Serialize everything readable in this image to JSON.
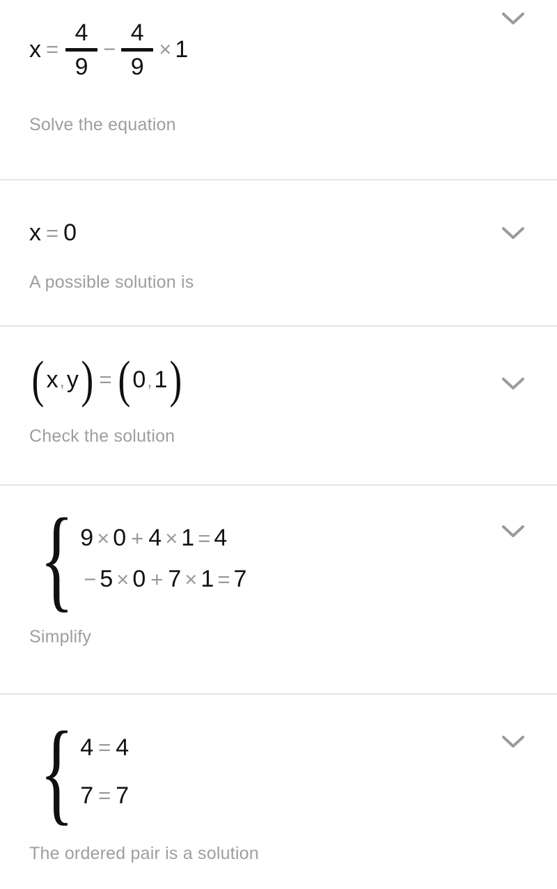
{
  "app": {
    "background_color": "#ffffff",
    "divider_color": "#e6e6e6",
    "rail_color": "#e2e2e2",
    "math_color": "#121212",
    "operator_color": "#9a9a9a",
    "caption_color": "#9e9e9e",
    "chevron_color": "#9b9b9b"
  },
  "steps": [
    {
      "id": "step-solve-equation",
      "caption": "Solve the equation",
      "toggle_icon": "chevron-down-icon",
      "expression": {
        "kind": "fraction-expression",
        "lhs": "x",
        "eq": "=",
        "frac1_num": "4",
        "frac1_den": "9",
        "minus": "−",
        "frac2_num": "4",
        "frac2_den": "9",
        "times": "×",
        "factor": "1"
      }
    },
    {
      "id": "step-possible-solution",
      "caption": "A possible solution is",
      "toggle_icon": "chevron-down-icon",
      "expression": {
        "kind": "simple-equation",
        "lhs": "x",
        "eq": "=",
        "rhs": "0"
      }
    },
    {
      "id": "step-check-solution",
      "caption": "Check the solution",
      "toggle_icon": "chevron-down-icon",
      "expression": {
        "kind": "ordered-pair-equation",
        "open1": "(",
        "var1": "x",
        "comma1": ",",
        "var2": "y",
        "close1": ")",
        "eq": "=",
        "open2": "(",
        "val1": "0",
        "comma2": ",",
        "val2": "1",
        "close2": ")"
      }
    },
    {
      "id": "step-simplify",
      "caption": "Simplify",
      "toggle_icon": "chevron-down-icon",
      "expression": {
        "kind": "system",
        "brace": "{",
        "rows": [
          {
            "t1": "9",
            "o1": "×",
            "t2": "0",
            "o2": "+",
            "t3": "4",
            "o3": "×",
            "t4": "1",
            "o4": "=",
            "t5": "4"
          },
          {
            "lead": "−",
            "t1": "5",
            "o1": "×",
            "t2": "0",
            "o2": "+",
            "t3": "7",
            "o3": "×",
            "t4": "1",
            "o4": "=",
            "t5": "7"
          }
        ]
      }
    },
    {
      "id": "step-ordered-pair-solution",
      "caption": "The ordered pair is a solution",
      "toggle_icon": "chevron-down-icon",
      "expression": {
        "kind": "system-simple",
        "brace": "{",
        "rows": [
          {
            "lhs": "4",
            "eq": "=",
            "rhs": "4"
          },
          {
            "lhs": "7",
            "eq": "=",
            "rhs": "7"
          }
        ]
      }
    }
  ]
}
